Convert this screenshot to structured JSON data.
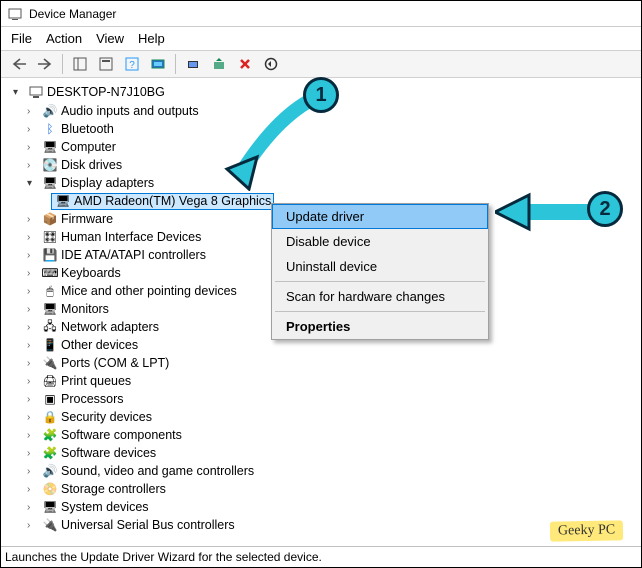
{
  "window": {
    "title": "Device Manager"
  },
  "menu": {
    "file": "File",
    "action": "Action",
    "view": "View",
    "help": "Help"
  },
  "tree": {
    "root": "DESKTOP-N7J10BG",
    "categories": [
      "Audio inputs and outputs",
      "Bluetooth",
      "Computer",
      "Disk drives",
      "Display adapters",
      "Firmware",
      "Human Interface Devices",
      "IDE ATA/ATAPI controllers",
      "Keyboards",
      "Mice and other pointing devices",
      "Monitors",
      "Network adapters",
      "Other devices",
      "Ports (COM & LPT)",
      "Print queues",
      "Processors",
      "Security devices",
      "Software components",
      "Software devices",
      "Sound, video and game controllers",
      "Storage controllers",
      "System devices",
      "Universal Serial Bus controllers"
    ],
    "display_child": "AMD Radeon(TM) Vega 8 Graphics"
  },
  "contextmenu": {
    "update": "Update driver",
    "disable": "Disable device",
    "uninstall": "Uninstall device",
    "scan": "Scan for hardware changes",
    "properties": "Properties"
  },
  "status": "Launches the Update Driver Wizard for the selected device.",
  "callouts": {
    "one": "1",
    "two": "2"
  },
  "watermark": "Geeky PC"
}
